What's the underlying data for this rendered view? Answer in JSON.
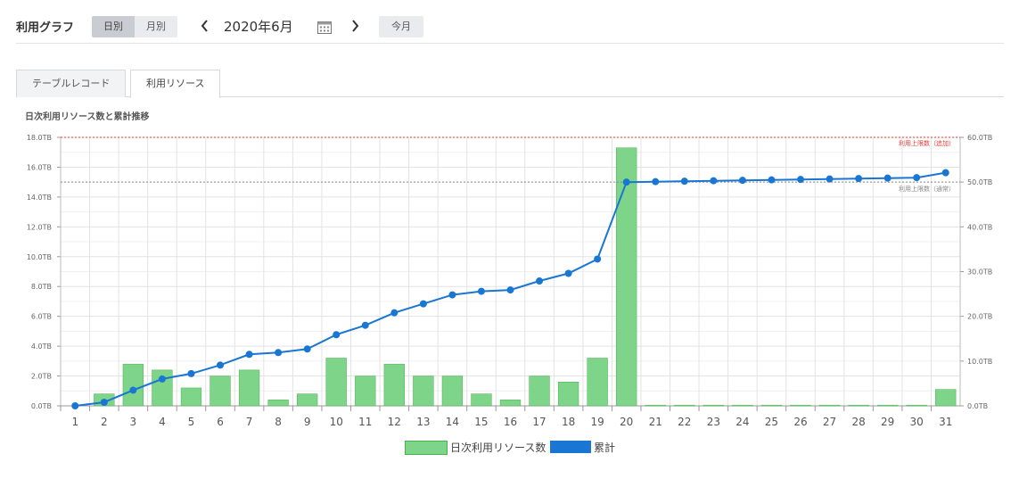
{
  "header": {
    "title": "利用グラフ",
    "segment": [
      "日別",
      "月別"
    ],
    "active_segment": 0,
    "prev_icon": "chevron-left-icon",
    "date": "2020年6月",
    "calendar_icon": "calendar-icon",
    "next_icon": "chevron-right-icon",
    "today": "今月"
  },
  "tabs": {
    "items": [
      "テーブルレコード",
      "利用リソース"
    ],
    "active": 1
  },
  "chart_title": "日次利用リソース数と累計推移",
  "colors": {
    "bar": "#7ed58a",
    "bar_border": "#4caf50",
    "line": "#1976d2",
    "limit_add": "#e53935",
    "limit_normal": "#888888",
    "grid": "#e3e3e3"
  },
  "chart_data": {
    "type": "bar",
    "categories": [
      "1",
      "2",
      "3",
      "4",
      "5",
      "6",
      "7",
      "8",
      "9",
      "10",
      "11",
      "12",
      "13",
      "14",
      "15",
      "16",
      "17",
      "18",
      "19",
      "20",
      "21",
      "22",
      "23",
      "24",
      "25",
      "26",
      "27",
      "28",
      "29",
      "30",
      "31"
    ],
    "series": [
      {
        "name": "日次利用リソース数",
        "type": "bar",
        "axis": "left",
        "values": [
          0,
          0.8,
          2.8,
          2.4,
          1.2,
          2.0,
          2.4,
          0.4,
          0.8,
          3.2,
          2.0,
          2.8,
          2.0,
          2.0,
          0.8,
          0.4,
          2.0,
          1.6,
          3.2,
          17.3,
          0.05,
          0.05,
          0.05,
          0.05,
          0.05,
          0.05,
          0.05,
          0.05,
          0.05,
          0.05,
          1.1
        ]
      },
      {
        "name": "累計",
        "type": "line",
        "axis": "right",
        "values": [
          0,
          0.8,
          3.5,
          6.0,
          7.2,
          9.1,
          11.5,
          11.9,
          12.7,
          15.9,
          18.0,
          20.8,
          22.8,
          24.8,
          25.6,
          25.9,
          27.9,
          29.6,
          32.8,
          50.0,
          50.1,
          50.2,
          50.3,
          50.4,
          50.5,
          50.6,
          50.7,
          50.8,
          50.9,
          51.0,
          52.1
        ]
      }
    ],
    "y_left": {
      "min": 0,
      "max": 18,
      "step": 2,
      "ticks": [
        "0.0TB",
        "2.0TB",
        "4.0TB",
        "6.0TB",
        "8.0TB",
        "10.0TB",
        "12.0TB",
        "14.0TB",
        "16.0TB",
        "18.0TB"
      ]
    },
    "y_right": {
      "min": 0,
      "max": 60,
      "step": 10,
      "ticks": [
        "0.0TB",
        "10.0TB",
        "20.0TB",
        "30.0TB",
        "40.0TB",
        "50.0TB",
        "60.0TB"
      ]
    },
    "reference_lines": [
      {
        "label": "利用上限数（追加）",
        "value": 60,
        "axis": "right",
        "color": "#e53935"
      },
      {
        "label": "利用上限数（通常）",
        "value": 50,
        "axis": "right",
        "color": "#888888"
      }
    ],
    "grid": true,
    "legend_position": "bottom"
  }
}
